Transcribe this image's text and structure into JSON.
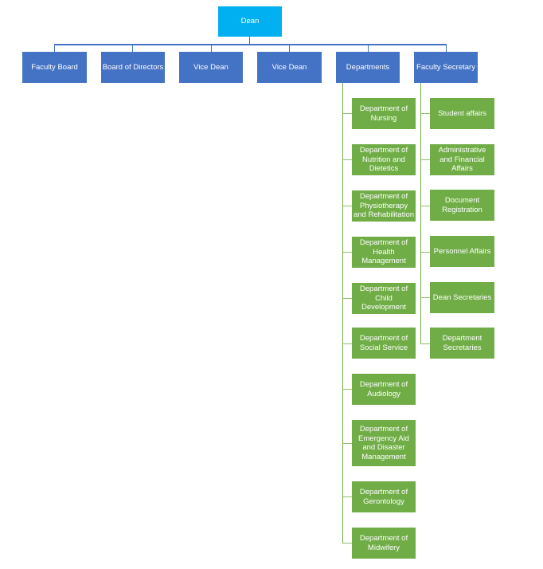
{
  "chart": {
    "root": {
      "label": "Dean",
      "color": "#00b0f0"
    },
    "level2": [
      {
        "label": "Faculty Board"
      },
      {
        "label": "Board of Directors"
      },
      {
        "label": "Vice Dean"
      },
      {
        "label": "Vice Dean"
      },
      {
        "label": "Departments"
      },
      {
        "label": "Faculty Secretary"
      }
    ],
    "level2_color": "#4472c4",
    "departments": [
      {
        "label": "Department of\nNursing"
      },
      {
        "label": "Department of\nNutrition and\nDietetics"
      },
      {
        "label": "Department of\nPhysiotherapy\nand Rehabilitation"
      },
      {
        "label": "Department of\nHealth\nManagement"
      },
      {
        "label": "Department of\nChild\nDevelopment"
      },
      {
        "label": "Department of\nSocial Service"
      },
      {
        "label": "Department of\nAudiology"
      },
      {
        "label": "Department of\nEmergency Aid\nand Disaster\nManagement"
      },
      {
        "label": "Department of\nGerontology"
      },
      {
        "label": "Department of\nMidwifery"
      }
    ],
    "faculty_secretary_units": [
      {
        "label": "Student affairs"
      },
      {
        "label": "Administrative\nand Financial\nAffairs"
      },
      {
        "label": "Document\nRegistration"
      },
      {
        "label": "Personnel Affairs"
      },
      {
        "label": "Dean Secretaries"
      },
      {
        "label": "Department\nSecretaries"
      }
    ],
    "leaf_color": "#70ad47"
  }
}
